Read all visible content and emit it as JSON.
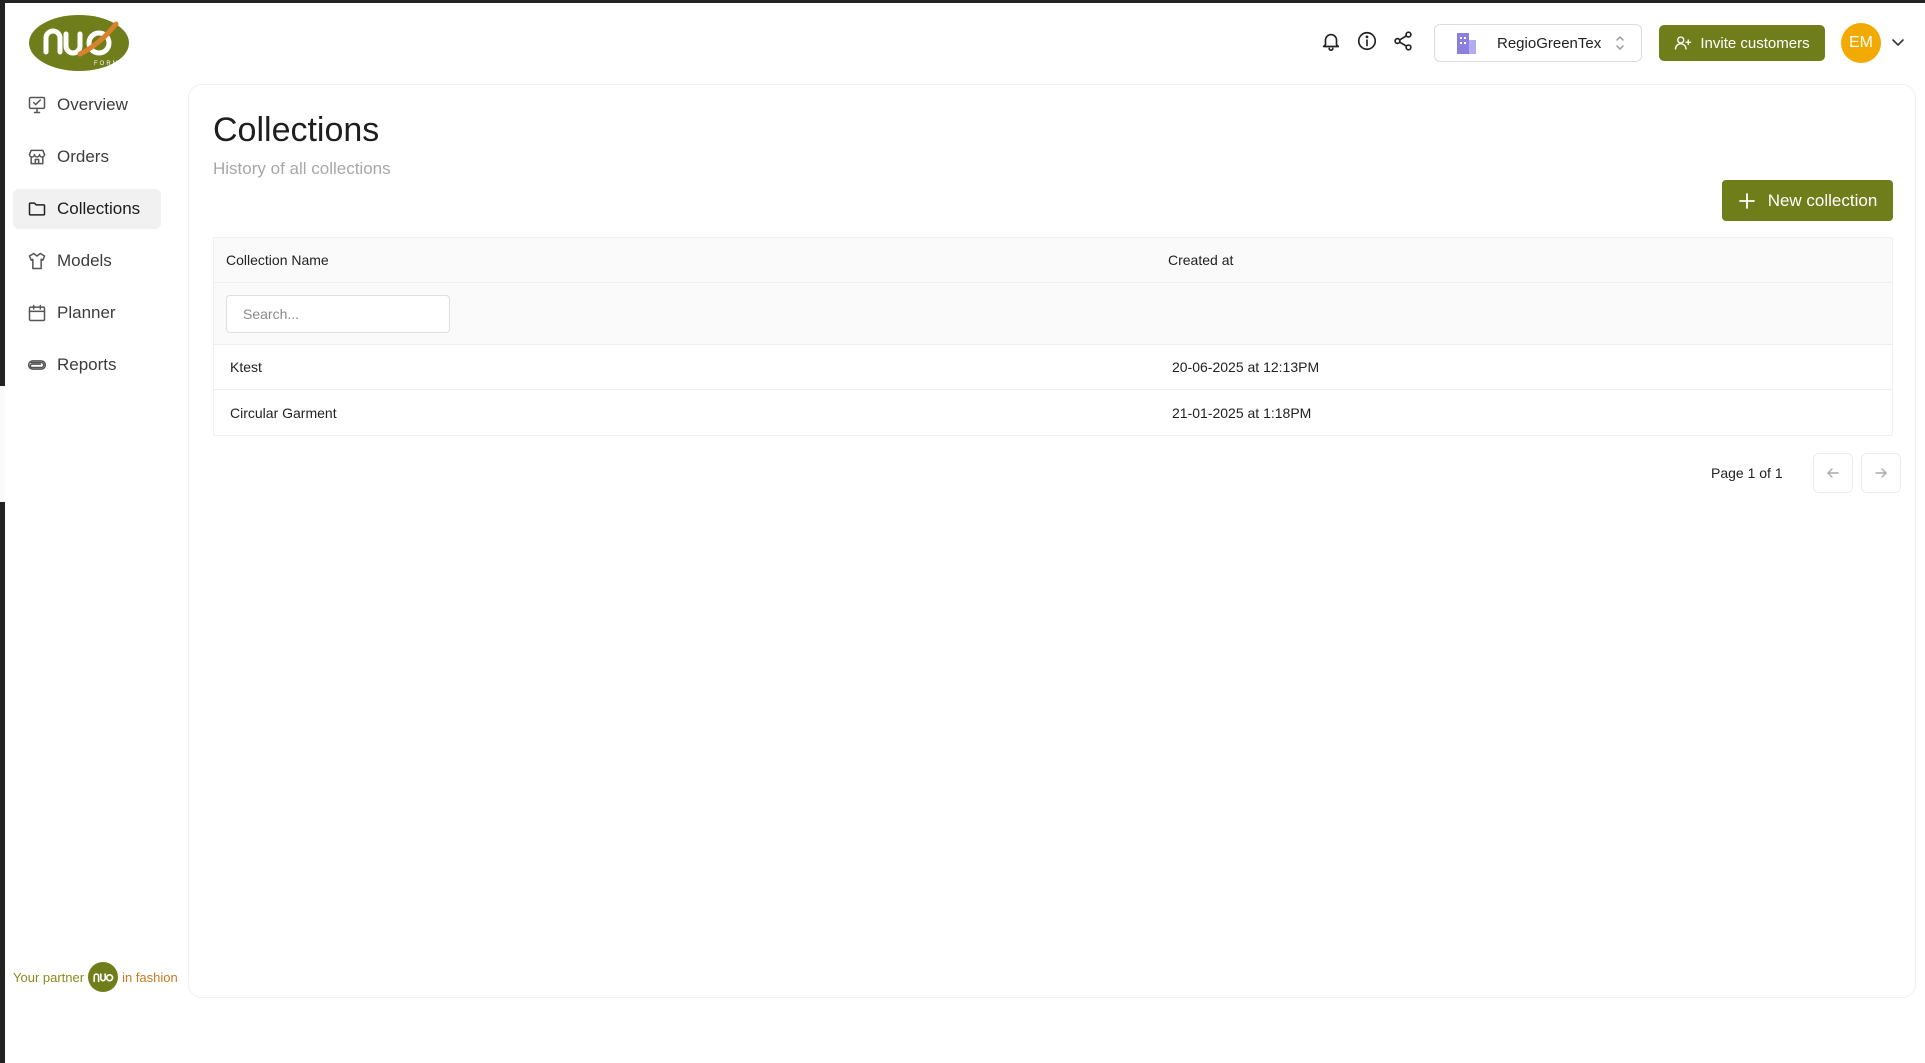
{
  "brand": {
    "logo_text": "nuo",
    "logo_subtext": "FORM",
    "colors": {
      "primary": "#6f7d1b",
      "accent_orange": "#c97a1f",
      "avatar": "#f2a900"
    }
  },
  "sidebar": {
    "items": [
      {
        "label": "Overview",
        "icon": "monitor-check-icon",
        "active": false
      },
      {
        "label": "Orders",
        "icon": "store-icon",
        "active": false
      },
      {
        "label": "Collections",
        "icon": "folder-icon",
        "active": true
      },
      {
        "label": "Models",
        "icon": "shirt-icon",
        "active": false
      },
      {
        "label": "Planner",
        "icon": "calendar-icon",
        "active": false
      },
      {
        "label": "Reports",
        "icon": "paperclip-icon",
        "active": false
      }
    ],
    "footer": {
      "prefix": "Your partner",
      "suffix": "in fashion"
    }
  },
  "header": {
    "icons": [
      "bell-icon",
      "info-icon",
      "share-icon"
    ],
    "org_select": {
      "value": "RegioGreenTex"
    },
    "invite_label": "Invite customers",
    "avatar_initials": "EM"
  },
  "main": {
    "title": "Collections",
    "subtitle": "History of all collections",
    "new_button_label": "New collection",
    "table": {
      "columns": [
        "Collection Name",
        "Created at"
      ],
      "search_placeholder": "Search...",
      "rows": [
        {
          "name": "Ktest",
          "created": "20-06-2025 at 12:13PM"
        },
        {
          "name": "Circular Garment",
          "created": "21-01-2025 at 1:18PM"
        }
      ]
    },
    "pagination": {
      "label": "Page 1 of 1"
    }
  }
}
